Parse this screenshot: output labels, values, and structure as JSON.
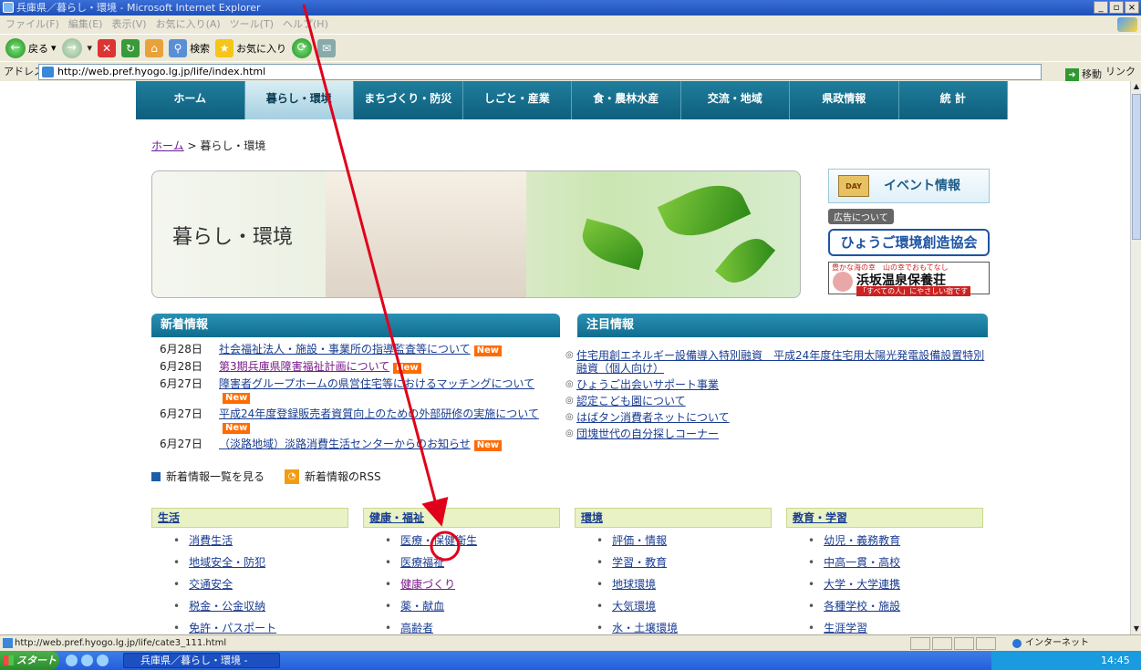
{
  "window": {
    "title": "兵庫県／暮らし・環境 - Microsoft Internet Explorer",
    "controls": [
      "_",
      "▫",
      "×"
    ]
  },
  "menu": [
    "ファイル(F)",
    "編集(E)",
    "表示(V)",
    "お気に入り(A)",
    "ツール(T)",
    "ヘルプ(H)"
  ],
  "toolbar": {
    "back": "戻る",
    "search": "検索",
    "favorites": "お気に入り"
  },
  "address": {
    "label": "アドレス(D)",
    "url": "http://web.pref.hyogo.lg.jp/life/index.html",
    "go": "移動",
    "links": "リンク »"
  },
  "gnav": [
    "ホーム",
    "暮らし・環境",
    "まちづくり・防災",
    "しごと・産業",
    "食・農林水産",
    "交流・地域",
    "県政情報",
    "統 計"
  ],
  "breadcrumb": {
    "home": "ホーム",
    "sep": " > ",
    "current": "暮らし・環境"
  },
  "hero": {
    "title": "暮らし・環境"
  },
  "side": {
    "event_label": "イベント情報",
    "event_cal": "DAY",
    "ad_label": "広告について",
    "banner1": "ひょうご環境創造協会",
    "banner2_sub": "豊かな海の幸　山の幸でおもてなし",
    "banner2_main": "浜坂温泉保養荘",
    "banner2_tag": "「すべての人」にやさしい宿です"
  },
  "news": {
    "heading": "新着情報",
    "items": [
      {
        "date": "6月28日",
        "text": "社会福祉法人・施設・事業所の指導監査等について",
        "new": "New"
      },
      {
        "date": "6月28日",
        "text": "第3期兵庫県障害福祉計画について",
        "new": "New"
      },
      {
        "date": "6月27日",
        "text": "障害者グループホームの県営住宅等におけるマッチングについて",
        "new": "New"
      },
      {
        "date": "6月27日",
        "text": "平成24年度登録販売者資質向上のための外部研修の実施について",
        "new": "New"
      },
      {
        "date": "6月27日",
        "text": "（淡路地域）淡路消費生活センターからのお知らせ",
        "new": "New"
      }
    ],
    "list_link": "新着情報一覧を見る",
    "rss_link": "新着情報のRSS"
  },
  "attention": {
    "heading": "注目情報",
    "items": [
      "住宅用創エネルギー設備導入特別融資　平成24年度住宅用太陽光発電設備設置特別融資（個人向け）",
      "ひょうご出会いサポート事業",
      "認定こども園について",
      "はばタン消費者ネットについて",
      "団塊世代の自分探しコーナー"
    ]
  },
  "categories": [
    {
      "title": "生活",
      "items": [
        "消費生活",
        "地域安全・防犯",
        "交通安全",
        "税金・公金収納",
        "免許・パスポート"
      ]
    },
    {
      "title": "健康・福祉",
      "items": [
        "医療・保健衛生",
        "医療福祉",
        "健康づくり",
        "薬・献血",
        "高齢者"
      ]
    },
    {
      "title": "環境",
      "items": [
        "評価・情報",
        "学習・教育",
        "地球環境",
        "大気環境",
        "水・土壌環境"
      ]
    },
    {
      "title": "教育・学習",
      "items": [
        "幼児・義務教育",
        "中高一貫・高校",
        "大学・大学連携",
        "各種学校・施設",
        "生涯学習"
      ]
    }
  ],
  "status": {
    "url": "http://web.pref.hyogo.lg.jp/life/cate3_111.html",
    "zone": "インターネット"
  },
  "taskbar": {
    "start": "スタート",
    "task": "兵庫県／暮らし・環境 -",
    "clock": "14:45"
  },
  "colors": {
    "nav": "#0e5f7d",
    "annotation": "#e0001b",
    "new_badge": "#ff6b00"
  }
}
